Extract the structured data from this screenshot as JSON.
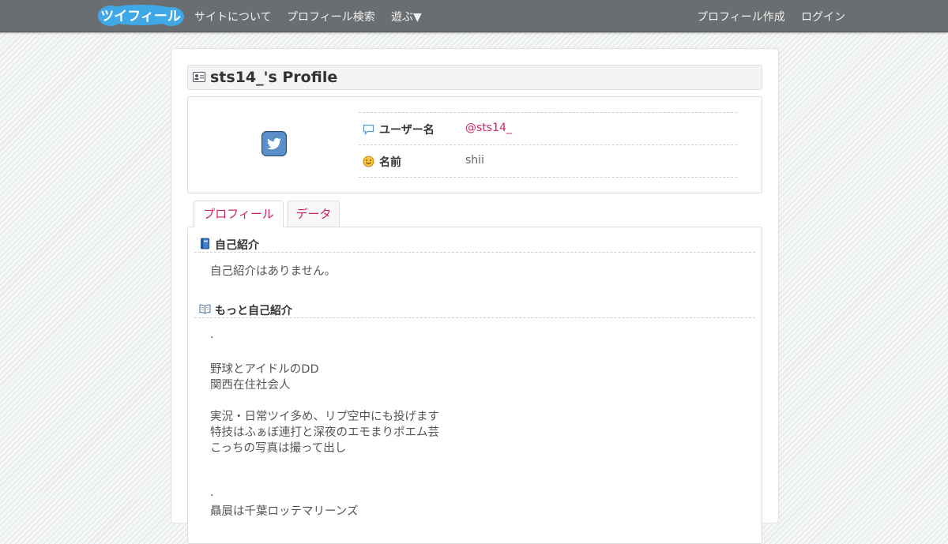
{
  "navbar": {
    "logo_text": "ツイフィール",
    "links_left": [
      "サイトについて",
      "プロフィール検索",
      "遊ぶ▼"
    ],
    "links_right": [
      "プロフィール作成",
      "ログイン"
    ]
  },
  "page": {
    "title": "sts14_'s Profile"
  },
  "profile": {
    "rows": [
      {
        "label": "ユーザー名",
        "value": "@sts14_"
      },
      {
        "label": "名前",
        "value": "shii"
      }
    ]
  },
  "tabs": [
    "プロフィール",
    "データ"
  ],
  "sections": {
    "intro": {
      "title": "自己紹介",
      "text": "自己紹介はありません。"
    },
    "more_intro": {
      "title": "もっと自己紹介",
      "lines": [
        ".",
        "",
        "野球とアイドルのDD",
        "関西在住社会人",
        "",
        "実況・日常ツイ多め、リプ空中にも投げます",
        "特技はふぁぼ連打と深夜のエモまりポエム芸",
        "こっちの写真は撮って出し",
        "",
        "",
        ".",
        "贔屓は千葉ロッテマリーンズ"
      ]
    }
  },
  "colors": {
    "navbar": "#6b6e70",
    "accent": "#d0245b",
    "logo": "#3fa9e8"
  }
}
